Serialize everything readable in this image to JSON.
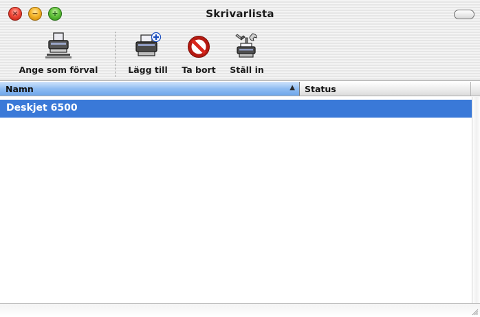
{
  "window": {
    "title": "Skrivarlista"
  },
  "toolbar": {
    "items": [
      {
        "label": "Ange som förval",
        "icon": "printer-default-icon"
      },
      {
        "label": "Lägg till",
        "icon": "printer-add-icon"
      },
      {
        "label": "Ta bort",
        "icon": "no-entry-icon"
      },
      {
        "label": "Ställ in",
        "icon": "printer-tools-icon"
      }
    ]
  },
  "table": {
    "columns": [
      {
        "label": "Namn",
        "sorted": "ascending"
      },
      {
        "label": "Status"
      }
    ],
    "rows": [
      {
        "name": "Deskjet 6500",
        "status": "",
        "selected": true
      }
    ]
  },
  "colors": {
    "selection": "#3a79d8",
    "header_active": "#8fbcf2",
    "close_button": "#f0493a",
    "minimize_button": "#f5b52a",
    "zoom_button": "#62c23c",
    "no_entry_red": "#d9261c"
  }
}
